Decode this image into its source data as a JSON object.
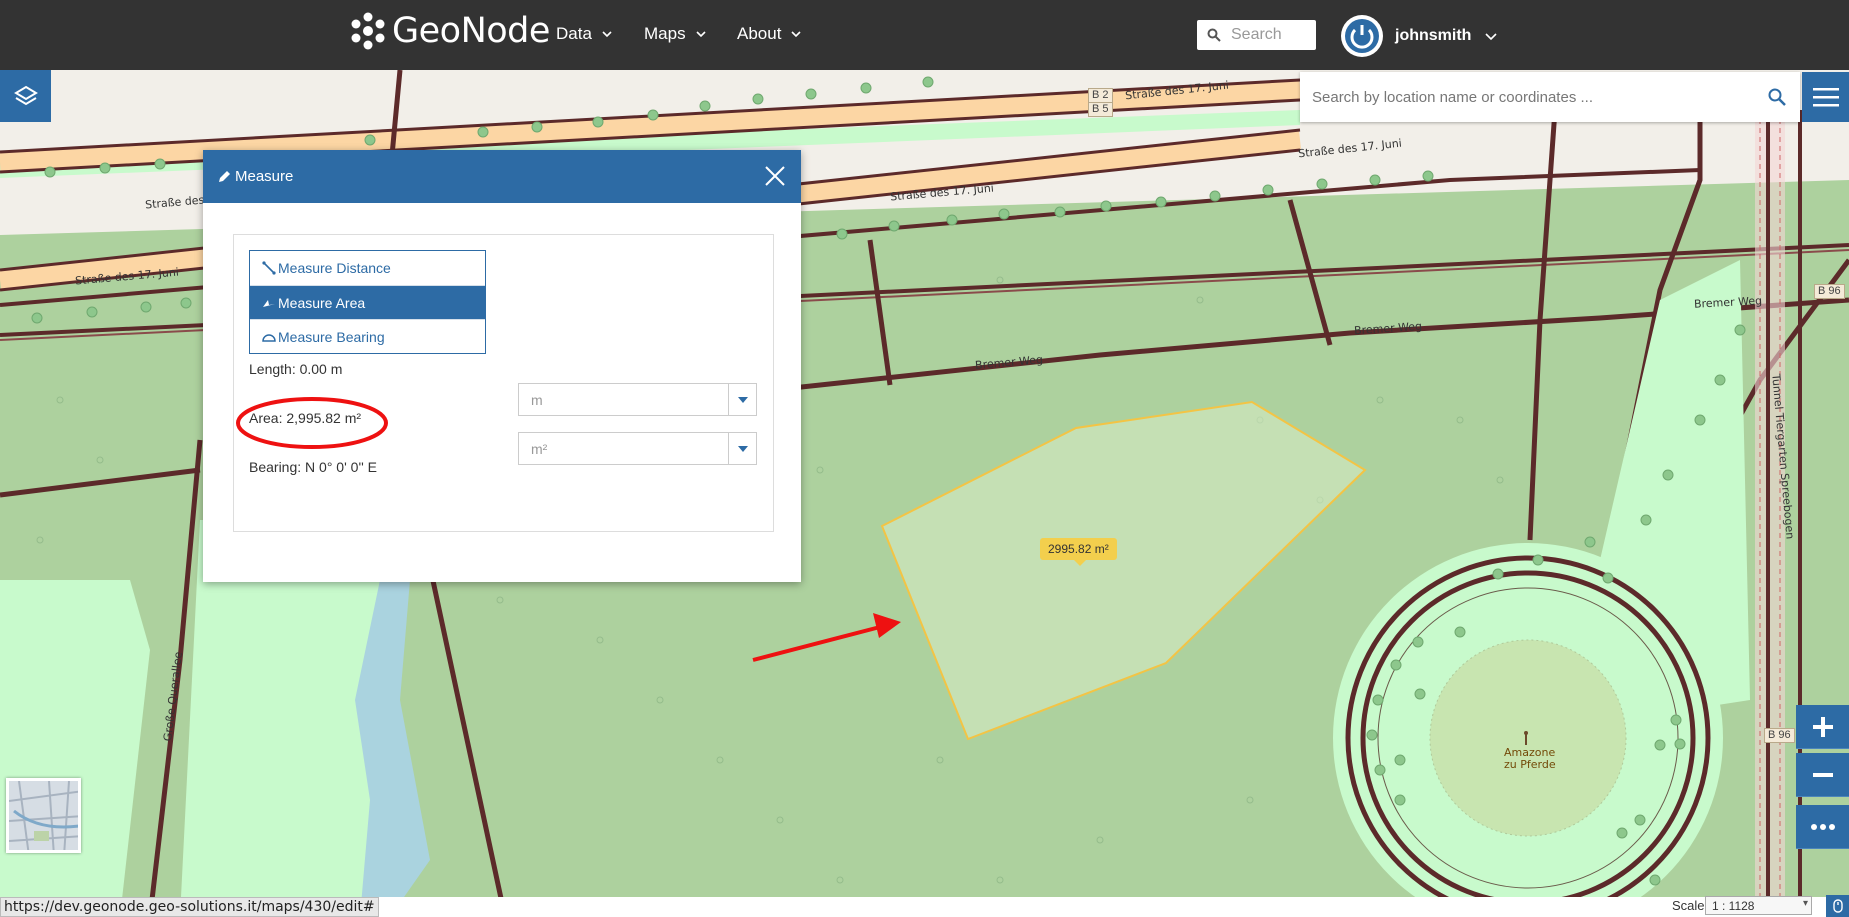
{
  "header": {
    "brand": "GeoNode",
    "nav": [
      {
        "label": "Data"
      },
      {
        "label": "Maps"
      },
      {
        "label": "About"
      }
    ],
    "search_placeholder": "Search",
    "username": "johnsmith"
  },
  "map": {
    "location_search_placeholder": "Search by location name or coordinates ...",
    "area_tooltip": "2995.82 m²",
    "street_labels": {
      "strasse_1": "Straße des 17. Juni",
      "strasse_2": "Straße des 17. Juni",
      "strasse_3": "Straße des 17. Juni",
      "strasse_4": "Straße des 17. Juni",
      "strasse_5": "Straße des 17. Juni",
      "bremer_1": "Bremer Weg",
      "bremer_2": "Bremer Weg",
      "bremer_3": "Bremer Weg",
      "querallee": "Große Querallee",
      "tunnel": "Tunnel Tiergarten Spreebogen",
      "monument_1": "Amazone",
      "monument_2": "zu Pferde"
    },
    "shields": {
      "b2": "B 2",
      "b5": "B 5",
      "b96_a": "B 96",
      "b96_b": "B 96"
    }
  },
  "measure_dialog": {
    "title": "Measure",
    "tools": [
      {
        "label": "Measure Distance",
        "active": false
      },
      {
        "label": "Measure Area",
        "active": true
      },
      {
        "label": "Measure Bearing",
        "active": false
      }
    ],
    "length": "Length: 0.00 m",
    "area": "Area: 2,995.82 m²",
    "bearing": "Bearing: N 0° 0' 0'' E",
    "length_unit": "m",
    "area_unit": "m²"
  },
  "footer": {
    "status_url": "https://dev.geonode.geo-solutions.it/maps/430/edit#",
    "scale_label": "Scale:",
    "scale_value": "1 : 1128"
  },
  "colors": {
    "accent": "#2d6ba5",
    "topbar": "#333333",
    "annotation": "#e11",
    "polygon_stroke": "#f3c445"
  }
}
